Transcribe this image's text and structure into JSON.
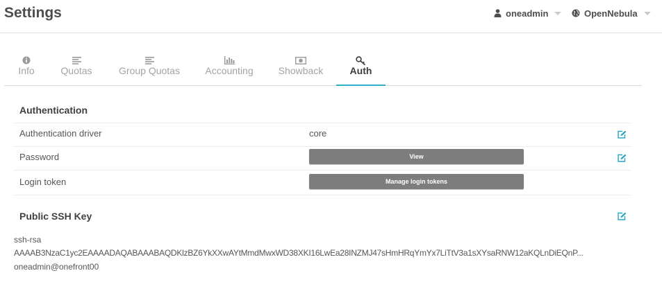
{
  "header": {
    "title": "Settings",
    "user_menu": {
      "label": "oneadmin",
      "icon": "user-icon"
    },
    "zone_menu": {
      "label": "OpenNebula",
      "icon": "globe-icon"
    }
  },
  "tabs": [
    {
      "label": "Info",
      "icon": "info-icon",
      "active": false
    },
    {
      "label": "Quotas",
      "icon": "align-left-icon",
      "active": false
    },
    {
      "label": "Group Quotas",
      "icon": "align-left-icon",
      "active": false
    },
    {
      "label": "Accounting",
      "icon": "bar-chart-icon",
      "active": false
    },
    {
      "label": "Showback",
      "icon": "money-icon",
      "active": false
    },
    {
      "label": "Auth",
      "icon": "key-icon",
      "active": true
    }
  ],
  "authentication": {
    "title": "Authentication",
    "driver": {
      "label": "Authentication driver",
      "value": "core"
    },
    "password": {
      "label": "Password",
      "button": "View"
    },
    "login_token": {
      "label": "Login token",
      "button": "Manage login tokens"
    }
  },
  "ssh": {
    "title": "Public SSH Key",
    "lines": [
      "ssh-rsa",
      "AAAAB3NzaC1yc2EAAAADAQABAAABAQDKlzBZ6YkXXwAYtMmdMwxWD38XKI16LwEa28INZMJ47sHmHRqYmYx7LiTtV3a1sXYsaRNW12aKQLnDiEQnP...",
      "oneadmin@onefront00"
    ]
  },
  "colors": {
    "accent": "#2fb0c9",
    "button_gray": "#7d7d7d",
    "edit_icon": "#2aa3c4"
  }
}
